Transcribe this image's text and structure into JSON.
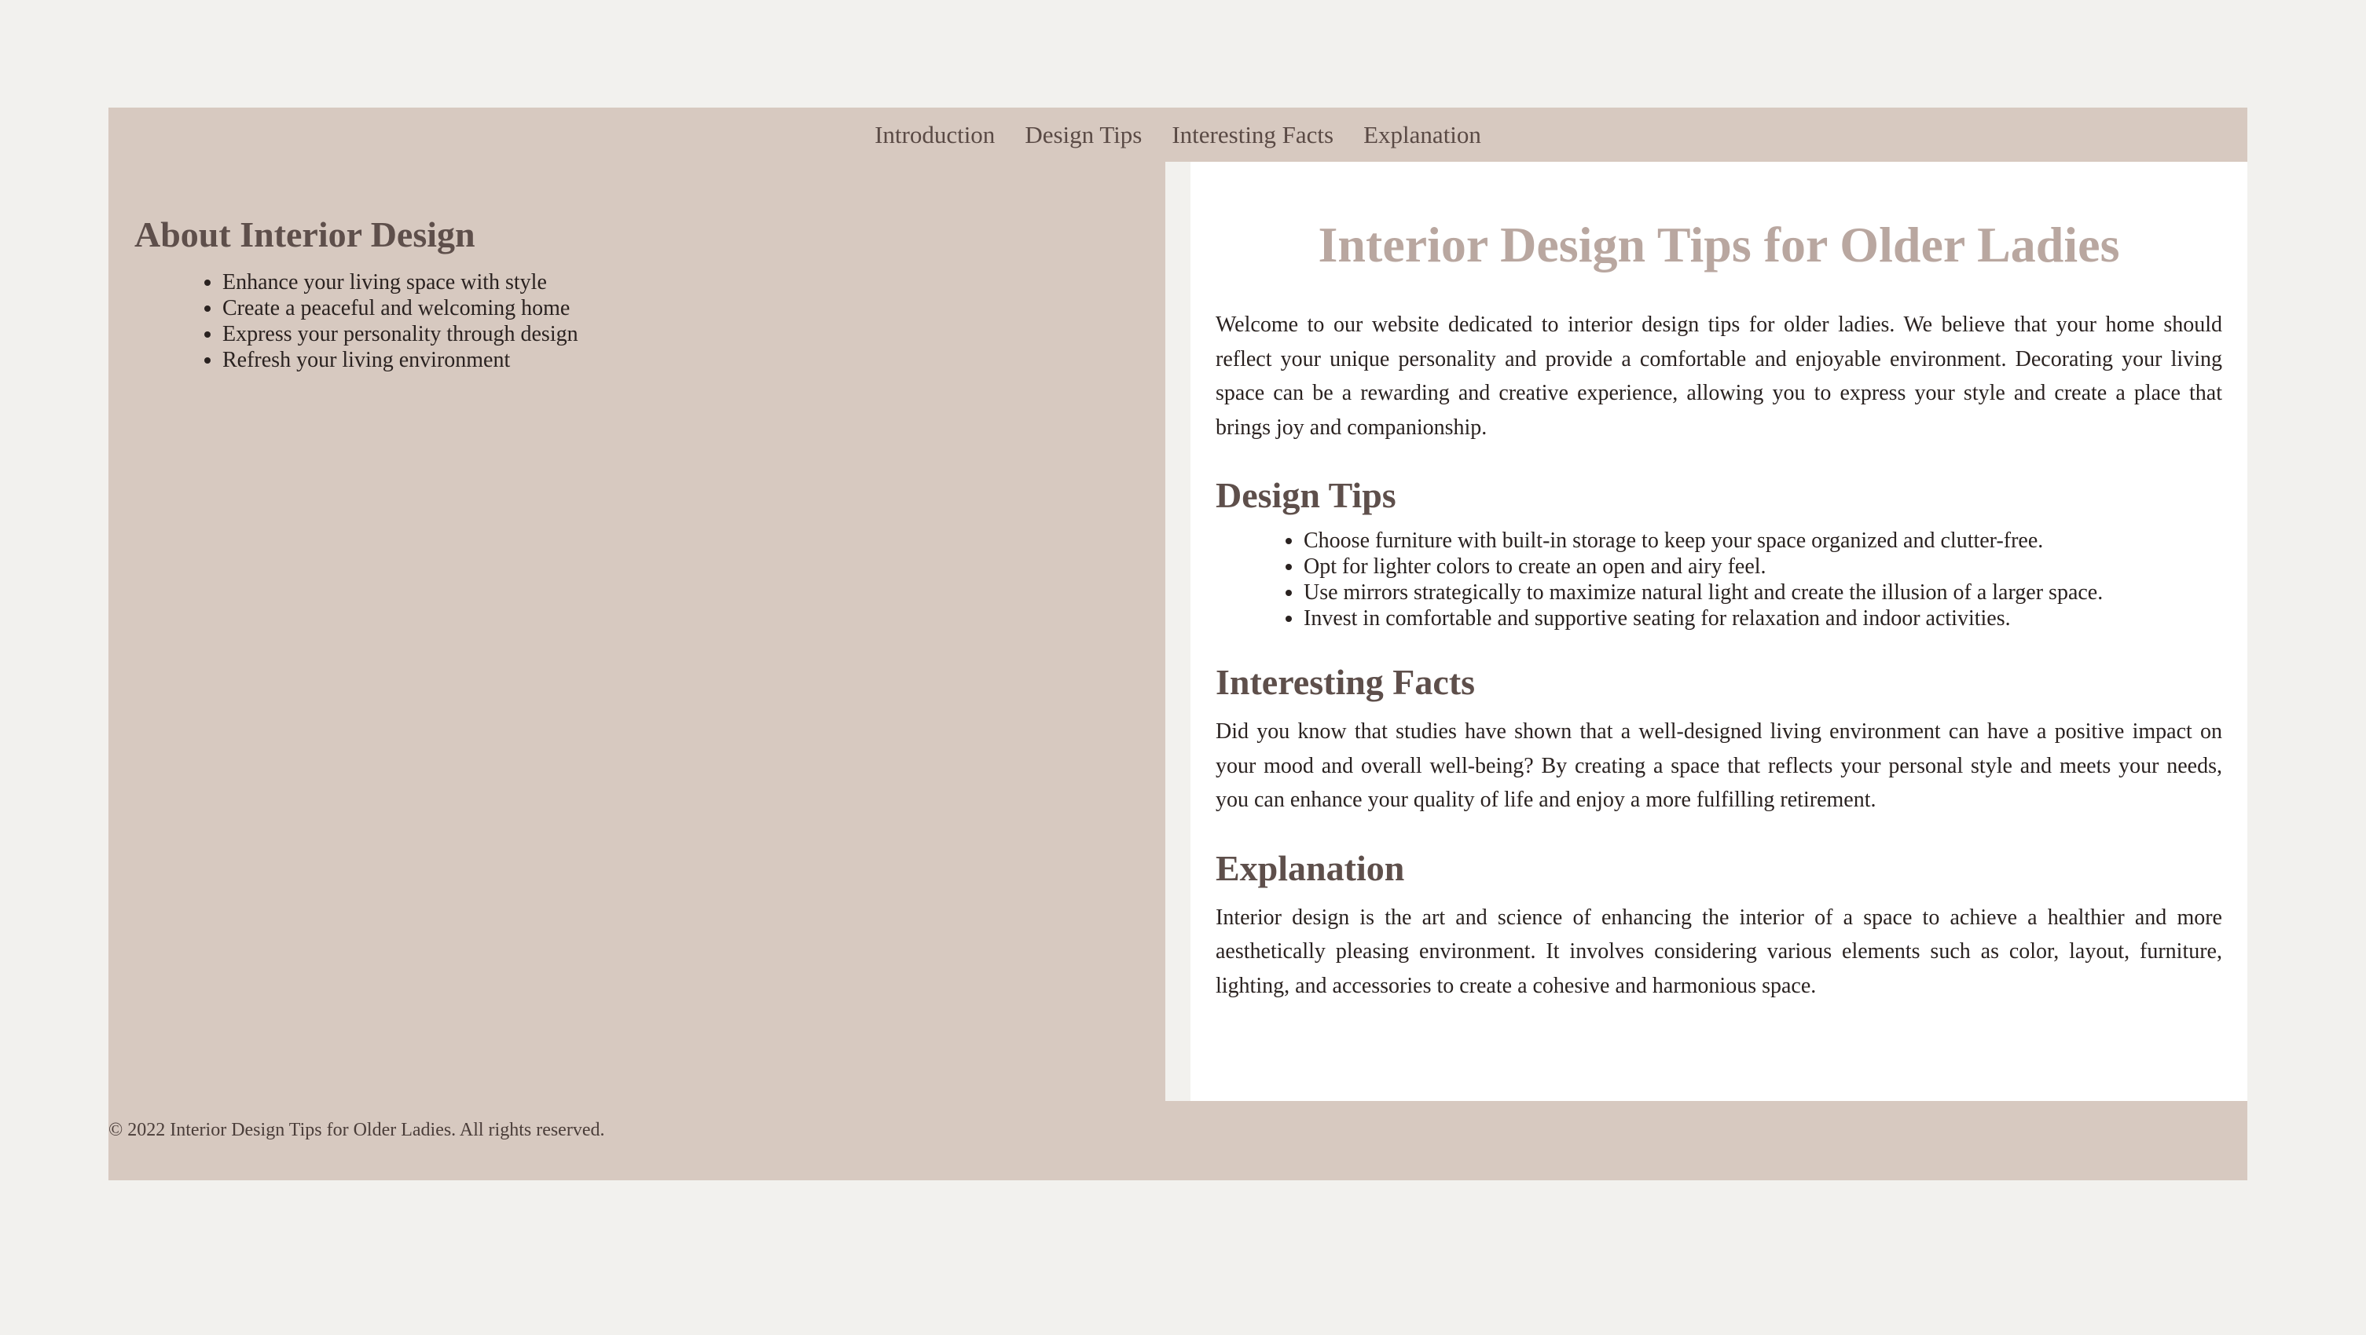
{
  "nav": {
    "items": [
      "Introduction",
      "Design Tips",
      "Interesting Facts",
      "Explanation"
    ]
  },
  "sidebar": {
    "title": "About Interior Design",
    "items": [
      "Enhance your living space with style",
      "Create a peaceful and welcoming home",
      "Express your personality through design",
      "Refresh your living environment"
    ]
  },
  "main": {
    "title": "Interior Design Tips for Older Ladies",
    "intro": "Welcome to our website dedicated to interior design tips for older ladies. We believe that your home should reflect your unique personality and provide a comfortable and enjoyable environment. Decorating your living space can be a rewarding and creative experience, allowing you to express your style and create a place that brings joy and companionship.",
    "design_tips": {
      "heading": "Design Tips",
      "items": [
        "Choose furniture with built-in storage to keep your space organized and clutter-free.",
        "Opt for lighter colors to create an open and airy feel.",
        "Use mirrors strategically to maximize natural light and create the illusion of a larger space.",
        "Invest in comfortable and supportive seating for relaxation and indoor activities."
      ]
    },
    "facts": {
      "heading": "Interesting Facts",
      "text": "Did you know that studies have shown that a well-designed living environment can have a positive impact on your mood and overall well-being? By creating a space that reflects your personal style and meets your needs, you can enhance your quality of life and enjoy a more fulfilling retirement."
    },
    "explanation": {
      "heading": "Explanation",
      "text": "Interior design is the art and science of enhancing the interior of a space to achieve a healthier and more aesthetically pleasing environment. It involves considering various elements such as color, layout, furniture, lighting, and accessories to create a cohesive and harmonious space."
    }
  },
  "footer": {
    "text": "© 2022 Interior Design Tips for Older Ladies. All rights reserved."
  },
  "colors": {
    "page_background": "#f2f1ee",
    "frame_background": "#d7c9c0",
    "content_background": "#ffffff",
    "main_title": "#b9a7a0",
    "heading": "#5e4f4b",
    "body_text": "#2a2220"
  }
}
